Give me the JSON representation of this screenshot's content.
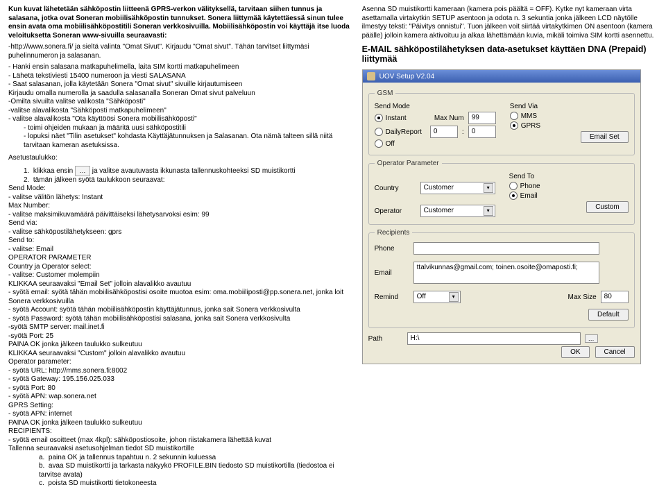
{
  "left": {
    "intro_bold": "Kun kuvat lähetetään sähköpostin liitteenä GPRS-verkon välityksellä, tarvitaan siihen tunnus ja salasana, jotka ovat Soneran mobiilisähköpostin tunnukset. Sonera liittymää käytettäessä sinun tulee ensin avata oma mobiilisähköpostitili Soneran verkkosivuilla. Mobiilisähköpostin voi käyttäjä itse luoda veloituksetta Soneran www-sivuilla seuraavasti:",
    "intro_line": "-http://www.sonera.fi/  ja sieltä valinta \"Omat Sivut\". Kirjaudu \"Omat sivut\". Tähän tarvitset liittymäsi puhelinnumeron ja salasanan.",
    "bul1": "- Hanki ensin salasana matkapuhelimella, laita SIM kortti matkapuhelimeen",
    "bul2": "- Lähetä tekstiviesti 15400 numeroon ja viesti SALASANA",
    "bul3": "- Saat salasanan, jolla käytetään Sonera \"Omat sivut\" sivuille kirjautumiseen",
    "bul4": "Kirjaudu omalla numerolla ja saadulla salasanalla Soneran Omat sivut palveluun",
    "bul5": "-Omilta sivuilta valitse valikosta \"Sähköposti\"",
    "bul6": "-valitse alavalikosta \"Sähköposti matkapuhelimeen\"",
    "bul7": "- valitse alavalikosta \"Ota käyttöösi Sonera mobiilisähköposti\"",
    "bul8": "toimi ohjeiden mukaan ja määritä uusi sähköpostitili",
    "bul9": "lopuksi näet \"Tilin asetukset\" kohdasta Käyttäjätunnuksen ja Salasanan. Ota nämä talteen sillä niitä tarvitaan kameran asetuksissa.",
    "asetus": "Asetustaulukko:",
    "step1a": "klikkaa ensin",
    "step1b": "ja valitse avautuvasta ikkunasta tallennuskohteeksi SD muistikortti",
    "step2": "tämän jälkeen syötä taulukkoon seuraavat:",
    "sendmode": "Send Mode:",
    "sendmode1": "- valitse välitön lähetys: Instant",
    "maxnum": "Max Number:",
    "maxnum1": "- valitse maksimikuvamäärä päivittäiseksi lähetysarvoksi esim: 99",
    "sendvia": "Send via:",
    "sendvia1": "- valitse sähköpostilähetykseen: gprs",
    "sendto": "Send to:",
    "sendto1": "- valitse: Email",
    "opparam": "OPERATOR PARAMETER",
    "opparam1": "Country ja Operator select:",
    "opparam2": "- valitse: Customer molempiin",
    "klikkaa1": "KLIKKAA seuraavaksi \"Email Set\" jolloin alavalikko avautuu",
    "email1": "- syötä email: syötä tähän mobiilisähköpostisi osoite muotoa esim: oma.mobiiliposti@pp.sonera.net, jonka loit Sonera verkkosivuilla",
    "email2": "- syötä Account: syötä tähän mobiilisähköpostin käyttäjätunnus, jonka sait Sonera verkkosivulta",
    "email3": "- syötä Password: syötä tähän mobiilisähköpostisi salasana, jonka sait Sonera verkkosivulta",
    "email4": "-syötä SMTP server: mail.inet.fi",
    "email5": "-syötä Port: 25",
    "paina1": "PAINA OK jonka jälkeen taulukko sulkeutuu",
    "klikkaa2": "KLIKKAA seuraavaksi \"Custom\" jolloin alavalikko avautuu",
    "opparam_hdr": "Operator parameter:",
    "op1": "- syötä URL: http://mms.sonera.fi:8002",
    "op2": "- syötä Gateway: 195.156.025.033",
    "op3": "- syötä Port: 80",
    "op4": "- syötä APN: wap.sonera.net",
    "gprs": "GPRS Setting:",
    "gprs1": "- syötä APN: internet",
    "paina2": "PAINA OK jonka jälkeen taulukko sulkeutuu",
    "recip": "RECIPIENTS:",
    "recip1": "- syötä email osoitteet (max 4kpl): sähköpostiosoite, johon riistakamera lähettää kuvat",
    "tall": "Tallenna seuraavaksi asetusohjelman tiedot SD muistikortille",
    "ta": "paina OK ja tallennus tapahtuu n. 2 sekunnin kuluessa",
    "tb": "avaa SD muistikortti ja tarkasta näkyykö PROFILE.BIN tiedosto SD muistikortilla (tiedostoa ei tarvitse avata)",
    "tc": "poista SD muistikortti tietokoneesta"
  },
  "right": {
    "p1": "Asenna SD muistikortti kameraan (kamera pois päältä = OFF). Kytke nyt kameraan virta asettamalla virtakytkin SETUP asentoon ja odota n. 3 sekuntia jonka jälkeen LCD näytölle ilmestyy teksti: \"Päivitys onnistui\". Tuon jälkeen voit siirtää virtakytkimen ON asentoon (kamera päälle) jolloin kamera aktivoituu ja alkaa lähettämään kuvia, mikäli toimiva SIM kortti asennettu.",
    "h2": "E-MAIL sähköpostilähetyksen data-asetukset käyttäen DNA (Prepaid) liittymää",
    "win_title": "UOV Setup V2.04",
    "fs_gsm": "GSM",
    "sendmode": "Send Mode",
    "sendvia": "Send Via",
    "instant": "Instant",
    "maxnum_lbl": "Max Num",
    "maxnum_val": "99",
    "mms": "MMS",
    "daily": "DailyReport",
    "zero": "0",
    "colon": ":",
    "gprs": "GPRS",
    "off": "Off",
    "emailset": "Email Set",
    "fs_op": "Operator Parameter",
    "sendto": "Send To",
    "country": "Country",
    "operator": "Operator",
    "customer": "Customer",
    "phone": "Phone",
    "email": "Email",
    "custom": "Custom",
    "fs_rec": "Recipients",
    "email_val": "ttalvikunnas@gmail.com; toinen.osoite@omaposti.fi;",
    "remind": "Remind",
    "maxsize": "Max Size",
    "maxsize_val": "80",
    "default": "Default",
    "path": "Path",
    "path_val": "H:\\",
    "browse": "…",
    "ok": "OK",
    "cancel": "Cancel"
  }
}
